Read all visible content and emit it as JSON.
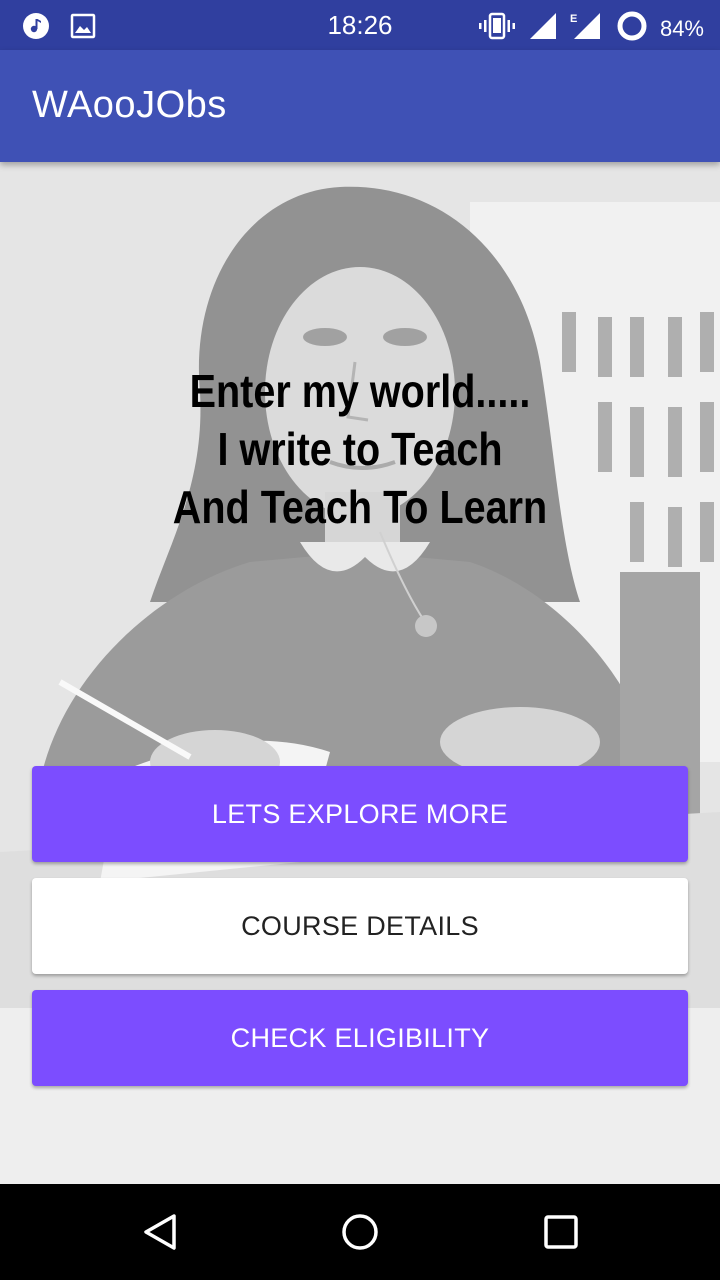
{
  "status_bar": {
    "time": "18:26",
    "battery": "84%",
    "icons": [
      "music-note-icon",
      "image-icon",
      "vibrate-icon",
      "signal-icon",
      "signal-e-icon",
      "battery-circle-icon"
    ]
  },
  "app_bar": {
    "title": "WAooJObs"
  },
  "hero": {
    "quote_lines": [
      "Enter my world.....",
      "I write to Teach",
      "And Teach To Learn"
    ]
  },
  "buttons": {
    "explore": "LETS EXPLORE MORE",
    "course": "COURSE DETAILS",
    "eligibility": "CHECK ELIGIBILITY"
  },
  "colors": {
    "status_bar": "#303f9f",
    "app_bar": "#3f51b5",
    "accent": "#7c4dff"
  },
  "nav_bar": {
    "icons": [
      "back-icon",
      "home-icon",
      "recents-icon"
    ]
  }
}
